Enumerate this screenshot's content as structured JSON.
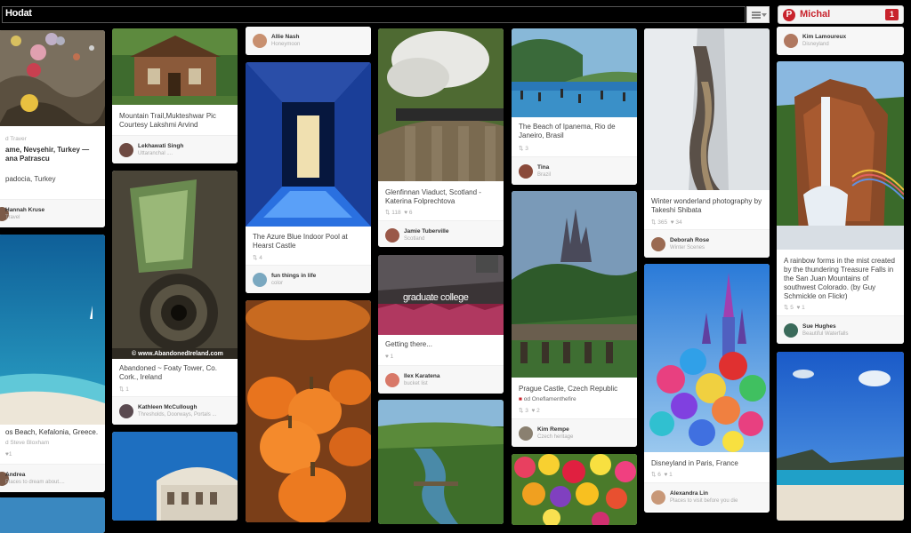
{
  "topbar": {
    "logo": "Hodat",
    "user_name": "Michal",
    "notification_count": "1"
  },
  "pins": {
    "c0a": {
      "line1": "ame, Nevşehir, Turkey —",
      "line2": "ana Patrascu",
      "pre": "d Traver",
      "desc": "padocia, Turkey",
      "attr_name": "Hannah Kruse",
      "attr_board": "Travel"
    },
    "c0b": {
      "desc1": "os Beach, Kefalonia, Greece.",
      "desc2": "d Steve Bloxham",
      "attr_name": "Andrea",
      "attr_board": "Places to dream about...."
    },
    "c1a": {
      "desc": "Mountain Trail,Mukteshwar Pic Courtesy Lakshmi Arvind",
      "attr_name": "Lekhawati Singh",
      "attr_board": "Uttaranchal ...."
    },
    "c1b": {
      "watermark": "© www.AbandonedIreland.com",
      "desc": "Abandoned ~ Foaty Tower, Co. Cork., Ireland",
      "stats": "1",
      "attr_name": "Kathleen McCullough",
      "attr_board": "Thresholds, Doorways, Portals ..."
    },
    "c2a": {
      "attr_name": "Allie Nash",
      "attr_board": "Honeymoon"
    },
    "c2b": {
      "desc": "The Azure Blue Indoor Pool at Hearst Castle",
      "stats": "4",
      "attr_name": "fun things in life",
      "attr_board": "color"
    },
    "c3a": {
      "desc": "Glenfinnan Viaduct, Scotland - Katerina Folprechtova",
      "stats_repins": "118",
      "stats_likes": "6",
      "attr_name": "Jamie Tuberville",
      "attr_board": "Scotland"
    },
    "c3b": {
      "overlay": "graduate college",
      "desc": "Getting there...",
      "stats": "1",
      "attr_name": "Ilex Karatena",
      "attr_board": "bucket list"
    },
    "c4a": {
      "desc": "The Beach of Ipanema, Rio de Janeiro, Brasil",
      "stats": "3",
      "attr_name": "Tina",
      "attr_board": "Brazil"
    },
    "c4b": {
      "desc": "Prague Castle, Czech Republic",
      "pre_attr": "od Oneflamenthefire",
      "stats_repins": "3",
      "stats_likes": "2",
      "attr_name": "Kim Rempe",
      "attr_board": "Czech heritage"
    },
    "c5a": {
      "desc": "Winter wonderland photography by Takeshi Shibata",
      "stats_repins": "365",
      "stats_likes": "34",
      "attr_name": "Deborah Rose",
      "attr_board": "Winter Scenes"
    },
    "c5b": {
      "desc": "Disneyland in Paris, France",
      "stats_repins": "6",
      "stats_likes": "1",
      "attr_name": "Alexandra Lin",
      "attr_board": "Places to visit before you die"
    },
    "c6a": {
      "attr_name": "Kim Lamoureux",
      "attr_board": "Disneyland"
    },
    "c6b": {
      "desc": "A rainbow forms in the mist created by the thundering Treasure Falls in the San Juan Mountains of southwest Colorado. (by Guy Schmickle on Flickr)",
      "stats_repins": "5",
      "stats_likes": "1",
      "attr_name": "Sue Hughes",
      "attr_board": "Beautiful Waterfalls"
    }
  }
}
